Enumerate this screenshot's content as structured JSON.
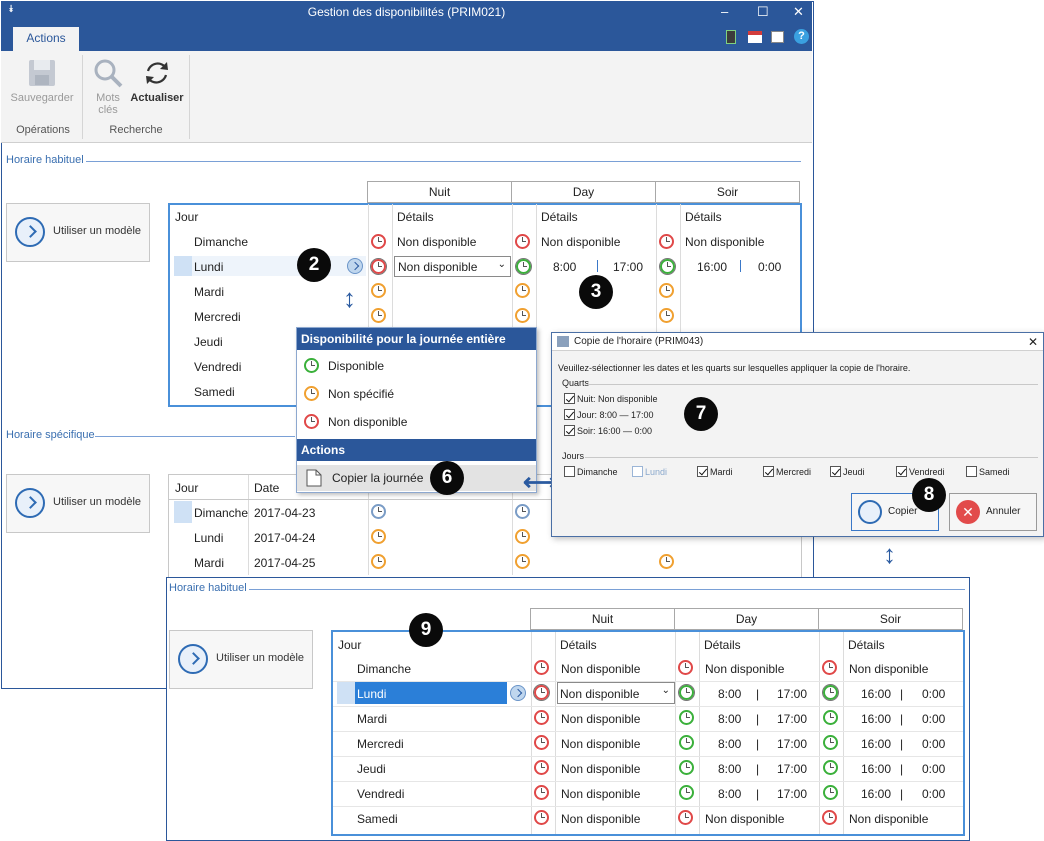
{
  "window": {
    "title": "Gestion des disponibilités (PRIM021)",
    "min": "–",
    "max": "☐",
    "close": "✕",
    "tab_actions": "Actions"
  },
  "ribbon": {
    "save": "Sauvegarder",
    "keywords_l1": "Mots",
    "keywords_l2": "clés",
    "refresh": "Actualiser",
    "group_ops": "Opérations",
    "group_search": "Recherche"
  },
  "habituel": {
    "title": "Horaire habituel",
    "model_btn": "Utiliser un modèle",
    "shifts": [
      "Nuit",
      "Day",
      "Soir"
    ],
    "col_jour": "Jour",
    "col_details": "Détails",
    "days": [
      "Dimanche",
      "Lundi",
      "Mardi",
      "Mercredi",
      "Jeudi",
      "Vendredi",
      "Samedi"
    ],
    "dim_nuit": "Non disponible",
    "dim_day": "Non disponible",
    "dim_soir": "Non disponible",
    "lundi_dropdown": "Non disponible",
    "lundi_day_start": "8:00",
    "lundi_day_end": "17:00",
    "lundi_soir_start": "16:00",
    "lundi_soir_end": "0:00"
  },
  "specifique": {
    "title": "Horaire spécifique",
    "model_btn": "Utiliser un modèle",
    "col_jour": "Jour",
    "col_date": "Date",
    "rows": [
      {
        "day": "Dimanche",
        "date": "2017-04-23"
      },
      {
        "day": "Lundi",
        "date": "2017-04-24"
      },
      {
        "day": "Mardi",
        "date": "2017-04-25"
      }
    ]
  },
  "menu": {
    "header": "Disponibilité pour la journée entière",
    "item_disponible": "Disponible",
    "item_non_specifie": "Non spécifié",
    "item_non_disponible": "Non disponible",
    "actions_header": "Actions",
    "copy_day": "Copier la journée"
  },
  "dialog": {
    "title": "Copie de l'horaire (PRIM043)",
    "instruction": "Veuillez-sélectionner les dates et les quarts sur lesquelles appliquer la copie de l'horaire.",
    "quarts_label": "Quarts",
    "quarts": [
      "Nuit: Non disponible",
      "Jour: 8:00 — 17:00",
      "Soir: 16:00 — 0:00"
    ],
    "jours_label": "Jours",
    "jours": [
      "Dimanche",
      "Lundi",
      "Mardi",
      "Mercredi",
      "Jeudi",
      "Vendredi",
      "Samedi"
    ],
    "jours_checked": [
      false,
      false,
      true,
      true,
      true,
      true,
      false
    ],
    "copy_btn": "Copier",
    "cancel_btn": "Annuler"
  },
  "result": {
    "title": "Horaire habituel",
    "model_btn": "Utiliser un modèle",
    "shifts": [
      "Nuit",
      "Day",
      "Soir"
    ],
    "col_jour": "Jour",
    "col_details": "Détails",
    "rows": [
      {
        "day": "Dimanche",
        "nuit": "Non disponible",
        "day_txt": "Non disponible",
        "soir_txt": "Non disponible"
      },
      {
        "day": "Lundi",
        "nuit": "Non disponible",
        "d1": "8:00",
        "d2": "17:00",
        "s1": "16:00",
        "s2": "0:00"
      },
      {
        "day": "Mardi",
        "nuit": "Non disponible",
        "d1": "8:00",
        "d2": "17:00",
        "s1": "16:00",
        "s2": "0:00"
      },
      {
        "day": "Mercredi",
        "nuit": "Non disponible",
        "d1": "8:00",
        "d2": "17:00",
        "s1": "16:00",
        "s2": "0:00"
      },
      {
        "day": "Jeudi",
        "nuit": "Non disponible",
        "d1": "8:00",
        "d2": "17:00",
        "s1": "16:00",
        "s2": "0:00"
      },
      {
        "day": "Vendredi",
        "nuit": "Non disponible",
        "d1": "8:00",
        "d2": "17:00",
        "s1": "16:00",
        "s2": "0:00"
      },
      {
        "day": "Samedi",
        "nuit": "Non disponible",
        "day_txt": "Non disponible",
        "soir_txt": "Non disponible"
      }
    ],
    "sep": "|"
  },
  "badges": [
    "2",
    "3",
    "6",
    "7",
    "8",
    "9"
  ],
  "colors": {
    "brand": "#2b579a",
    "accent": "#4a90d9",
    "red": "#e04848",
    "orange": "#f0a030",
    "green": "#3ab03a"
  }
}
